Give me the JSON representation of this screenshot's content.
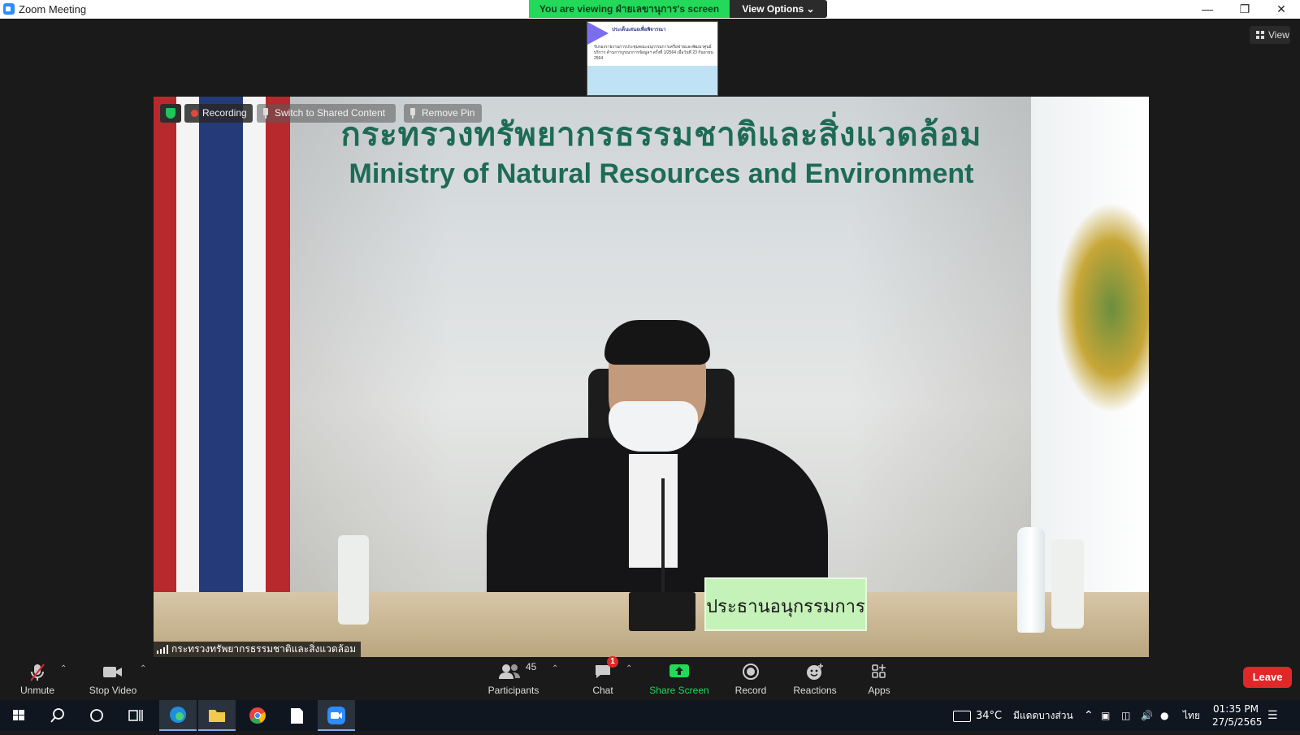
{
  "window": {
    "title": "Zoom Meeting"
  },
  "share_banner": {
    "viewing_text": "You are viewing ฝ่ายเลขานุการ's screen",
    "view_options": "View Options ⌄"
  },
  "view_button": {
    "label": "View"
  },
  "thumbnail": {
    "title": "ประเด็นเสนอเพื่อพิจารณา",
    "body": "รับรองรายงานการประชุมคณะอนุกรรมการเครือข่ายและพัฒนาศูนย์บริการ ด้านการบูรณาการข้อมูลฯ ครั้งที่ 1/2564 เมื่อวันที่ 23 กันยายน 2564"
  },
  "video": {
    "sign_thai": "กระทรวงทรัพยากรธรรมชาติและสิ่งแวดล้อม",
    "sign_english": "Ministry of Natural Resources and Environment",
    "nameplate": "ประธานอนุกรรมการ",
    "participant_name": "กระทรวงทรัพยากรธรรมชาติและสิ่งแวดล้อม"
  },
  "overlay": {
    "recording": "Recording",
    "switch": "Switch to Shared Content",
    "remove_pin": "Remove Pin"
  },
  "toolbar": {
    "unmute": "Unmute",
    "stop_video": "Stop Video",
    "participants": "Participants",
    "participants_count": "45",
    "chat": "Chat",
    "chat_badge": "1",
    "share_screen": "Share Screen",
    "record": "Record",
    "reactions": "Reactions",
    "apps": "Apps",
    "leave": "Leave"
  },
  "taskbar": {
    "weather": "34°C",
    "weather_desc": "มีแดดบางส่วน",
    "lang": "ไทย",
    "time": "01:35 PM",
    "date": "27/5/2565"
  },
  "colors": {
    "share_green": "#23d959",
    "leave_red": "#e02828",
    "zoom_blue": "#2d8cff"
  }
}
